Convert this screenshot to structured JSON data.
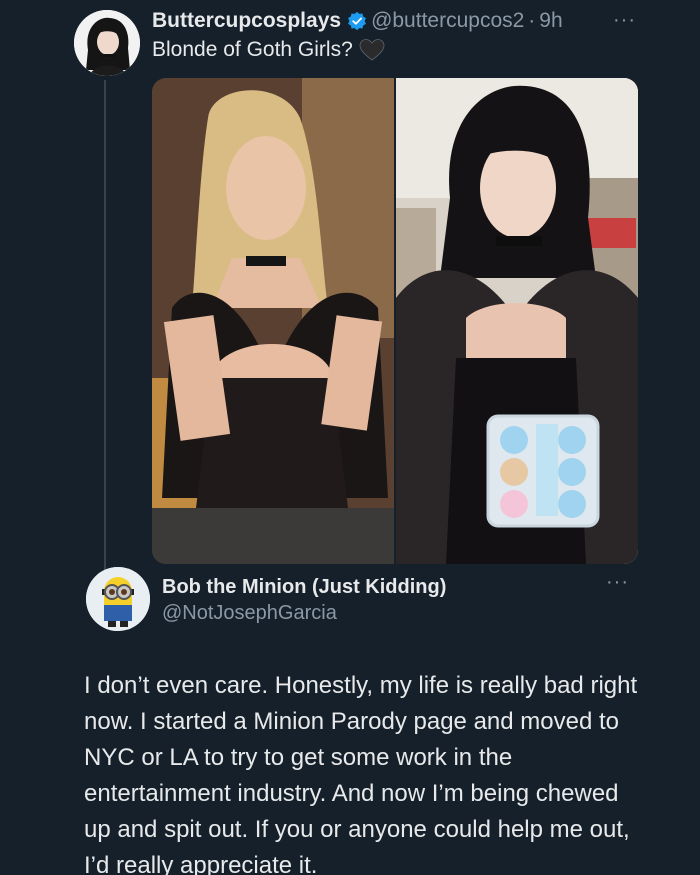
{
  "original_post": {
    "display_name": "Buttercupcosplays",
    "handle": "@buttercupcos2",
    "separator": "·",
    "time": "9h",
    "more": "···",
    "text": "Blonde of Goth Girls?",
    "icons": [
      "verified-badge-icon",
      "black-heart-icon",
      "more-options-icon"
    ],
    "media": [
      "blonde-woman-photo",
      "goth-woman-photo"
    ]
  },
  "reply": {
    "display_name": "Bob the Minion (Just Kidding)",
    "handle": "@NotJosephGarcia",
    "more": "···",
    "text": "I don’t even care. Honestly, my life is really bad right now. I started a Minion Parody page and moved to NYC or LA to try to get some work in the entertainment industry. And now I’m being chewed up and spit out. If you or anyone could help me out, I’d really appreciate it."
  },
  "colors": {
    "background": "#15202b",
    "text_primary": "#e7e9ea",
    "text_secondary": "#8b98a5",
    "verified": "#1d9bf0",
    "thread_line": "#38444d"
  }
}
